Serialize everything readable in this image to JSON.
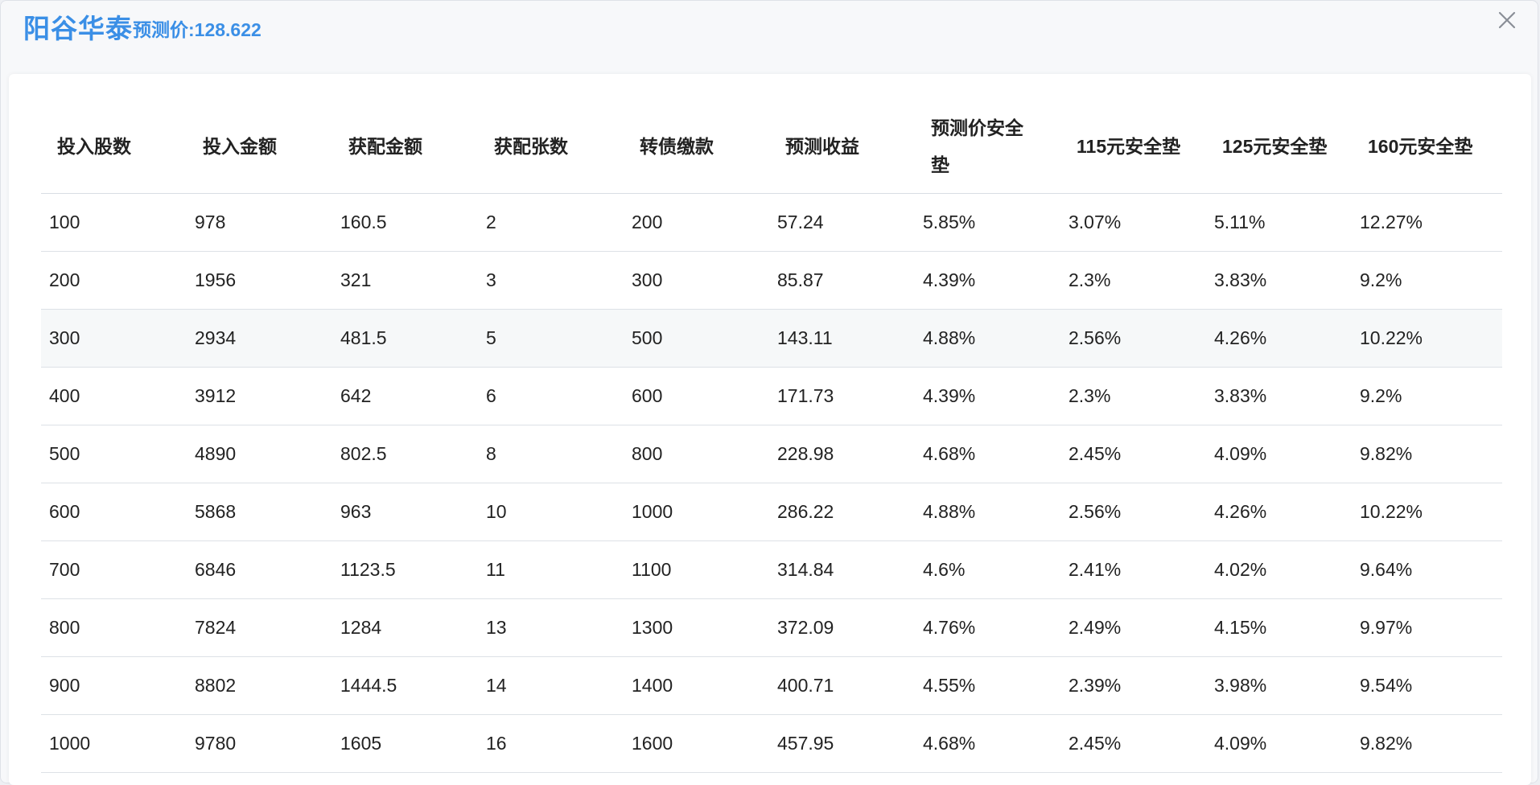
{
  "header": {
    "title": "阳谷华泰",
    "subtitle": "预测价:128.622"
  },
  "table": {
    "columns": [
      "投入股数",
      "投入金额",
      "获配金额",
      "获配张数",
      "转债缴款",
      "预测收益",
      "预测价安全垫",
      "115元安全垫",
      "125元安全垫",
      "160元安全垫"
    ],
    "rows": [
      [
        "100",
        "978",
        "160.5",
        "2",
        "200",
        "57.24",
        "5.85%",
        "3.07%",
        "5.11%",
        "12.27%"
      ],
      [
        "200",
        "1956",
        "321",
        "3",
        "300",
        "85.87",
        "4.39%",
        "2.3%",
        "3.83%",
        "9.2%"
      ],
      [
        "300",
        "2934",
        "481.5",
        "5",
        "500",
        "143.11",
        "4.88%",
        "2.56%",
        "4.26%",
        "10.22%"
      ],
      [
        "400",
        "3912",
        "642",
        "6",
        "600",
        "171.73",
        "4.39%",
        "2.3%",
        "3.83%",
        "9.2%"
      ],
      [
        "500",
        "4890",
        "802.5",
        "8",
        "800",
        "228.98",
        "4.68%",
        "2.45%",
        "4.09%",
        "9.82%"
      ],
      [
        "600",
        "5868",
        "963",
        "10",
        "1000",
        "286.22",
        "4.88%",
        "2.56%",
        "4.26%",
        "10.22%"
      ],
      [
        "700",
        "6846",
        "1123.5",
        "11",
        "1100",
        "314.84",
        "4.6%",
        "2.41%",
        "4.02%",
        "9.64%"
      ],
      [
        "800",
        "7824",
        "1284",
        "13",
        "1300",
        "372.09",
        "4.76%",
        "2.49%",
        "4.15%",
        "9.97%"
      ],
      [
        "900",
        "8802",
        "1444.5",
        "14",
        "1400",
        "400.71",
        "4.55%",
        "2.39%",
        "3.98%",
        "9.54%"
      ],
      [
        "1000",
        "9780",
        "1605",
        "16",
        "1600",
        "457.95",
        "4.68%",
        "2.45%",
        "4.09%",
        "9.82%"
      ]
    ]
  }
}
